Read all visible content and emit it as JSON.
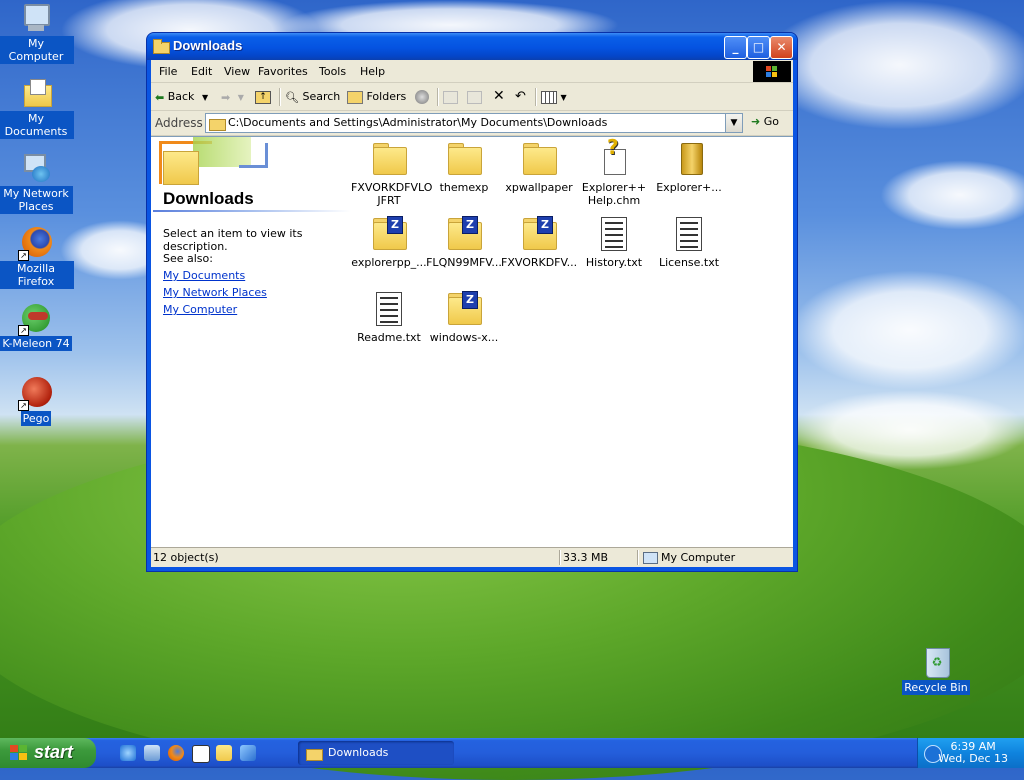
{
  "desktop": {
    "icons": [
      {
        "label": "My Computer"
      },
      {
        "label": "My Documents"
      },
      {
        "label": "My Network Places"
      },
      {
        "label": "Mozilla Firefox"
      },
      {
        "label": "K-Meleon 74"
      },
      {
        "label": "Pego"
      },
      {
        "label": "Recycle Bin"
      }
    ]
  },
  "window": {
    "title": "Downloads",
    "menu": [
      "File",
      "Edit",
      "View",
      "Favorites",
      "Tools",
      "Help"
    ],
    "toolbar": {
      "back": "Back",
      "search": "Search",
      "folders": "Folders"
    },
    "address": {
      "label": "Address",
      "path": "C:\\Documents and Settings\\Administrator\\My Documents\\Downloads",
      "go": "Go"
    },
    "left_pane": {
      "title": "Downloads",
      "description": "Select an item to view its description.",
      "see_also": "See also:",
      "links": [
        "My Documents",
        "My Network Places",
        "My Computer"
      ]
    },
    "files": [
      {
        "name": "FXVORKDFVLO JFRT",
        "type": "folder"
      },
      {
        "name": "themexp",
        "type": "folder"
      },
      {
        "name": "xpwallpaper",
        "type": "folder"
      },
      {
        "name": "Explorer++ Help.chm",
        "type": "help"
      },
      {
        "name": "Explorer+...",
        "type": "app"
      },
      {
        "name": "explorerpp_...",
        "type": "zip"
      },
      {
        "name": "FLQN99MFV...",
        "type": "zip"
      },
      {
        "name": "FXVORKDFV...",
        "type": "zip"
      },
      {
        "name": "History.txt",
        "type": "text"
      },
      {
        "name": "License.txt",
        "type": "text"
      },
      {
        "name": "Readme.txt",
        "type": "text"
      },
      {
        "name": "windows-x...",
        "type": "zip"
      }
    ],
    "status": {
      "objects": "12 object(s)",
      "size": "33.3 MB",
      "location": "My Computer"
    }
  },
  "taskbar": {
    "start": "start",
    "task": "Downloads",
    "clock": {
      "time": "6:39 AM",
      "date": "Wed, Dec 13"
    }
  }
}
